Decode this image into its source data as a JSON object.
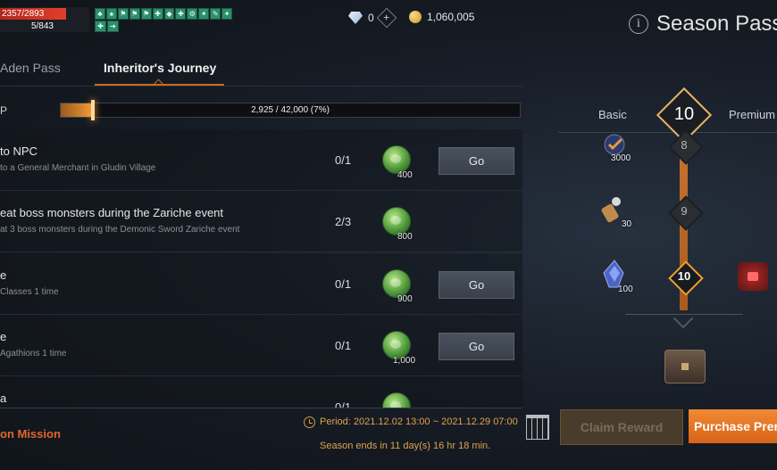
{
  "player": {
    "hp": "2357/2893",
    "mp": "5/843"
  },
  "buffs_row1": [
    "♣",
    "♠",
    "⚑",
    "⚑",
    "⚑",
    "✚",
    "◆",
    "✚",
    "⚙",
    "✦",
    "✎",
    "✦",
    "✚",
    "✚"
  ],
  "buffs_row2": [
    "✚",
    "➜"
  ],
  "currency": {
    "diamonds": "0",
    "adena": "1,060,005"
  },
  "header": {
    "title": "Season Pass"
  },
  "tabs": {
    "tab1": "Aden Pass",
    "tab2": "Inheritor's Journey"
  },
  "xp": {
    "label": "P",
    "text": "2,925 / 42,000 (7%)",
    "fraction": 0.07
  },
  "missions": [
    {
      "title": "to NPC",
      "desc": "to a General Merchant in Gludin Village",
      "progress": "0/1",
      "reward": "400",
      "go": "Go"
    },
    {
      "title": "eat boss monsters during the Zariche event",
      "desc": "at 3 boss monsters during the Demonic Sword Zariche event",
      "progress": "2/3",
      "reward": "800",
      "go": ""
    },
    {
      "title": "e",
      "desc": "Classes 1 time",
      "progress": "0/1",
      "reward": "900",
      "go": "Go"
    },
    {
      "title": "e",
      "desc": "Agathions 1 time",
      "progress": "0/1",
      "reward": "1,000",
      "go": "Go"
    },
    {
      "title": "a",
      "desc": "",
      "progress": "0/1",
      "reward": "",
      "go": ""
    }
  ],
  "footer": {
    "ongoing": "on Mission",
    "period": "Period: 2021.12.02 13:00 ~ 2021.12.29 07:00",
    "season_ends": "Season ends in 11 day(s) 16 hr 18 min.",
    "claim": "Claim Reward",
    "purchase": "Purchase Premium"
  },
  "pass": {
    "basic_label": "Basic",
    "premium_label": "Premium",
    "current_level": "10",
    "levels": [
      "8",
      "9",
      "10"
    ],
    "rewards": [
      "3000",
      "30",
      "100"
    ]
  },
  "colors": {
    "accent": "#e2662a",
    "purchase": "#f08a34",
    "track": "#c87630"
  }
}
